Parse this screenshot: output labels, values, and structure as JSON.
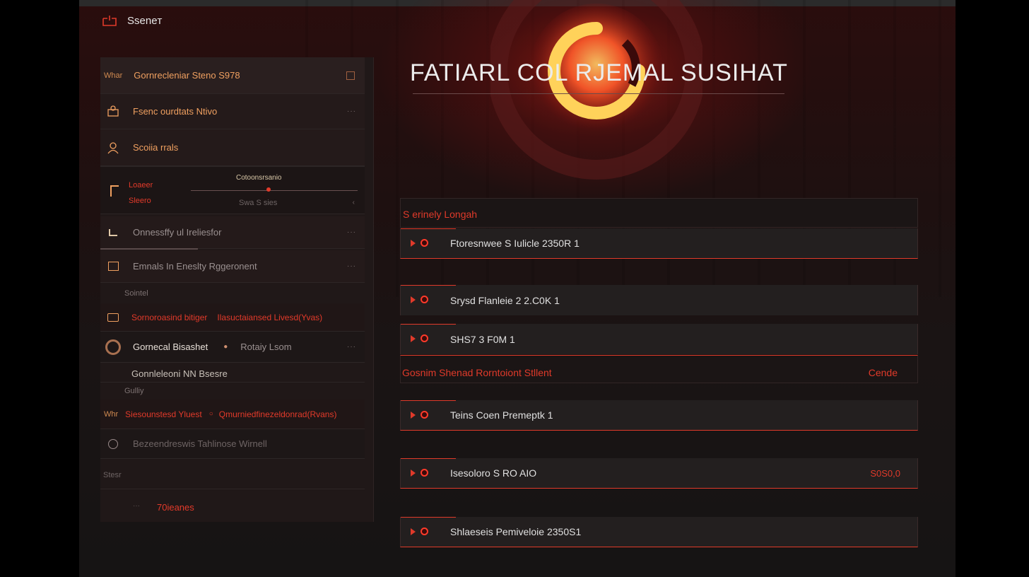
{
  "app": {
    "brand": "Sseneт",
    "title": "FATIARL COL RJEMAL SUSIHAT"
  },
  "sidebar": {
    "items": [
      {
        "prefix": "Whar",
        "label": "Gornrecleniar Steno S978"
      },
      {
        "label": "Fsenc ourdtats Ntivo"
      },
      {
        "label": "Scoiia rrals"
      },
      {
        "label": "Onnessffy ul Ireliesfor"
      },
      {
        "label": "Emnals In Eneslty Rggeronent"
      }
    ],
    "slider": {
      "title": "Cotoonsrsanio",
      "left_top": "Loaeer",
      "left_bottom": "Sleero",
      "caption": "Swa S sies"
    },
    "section_a": "Sointel",
    "red_row": {
      "left": "Sornoroasind bitiger",
      "right": "Ilasuctaiansed Livesd(Yvas)"
    },
    "toggle_row": {
      "label": "Gornecal Bisashet",
      "right": "Rotaiy Lsom"
    },
    "note": "Gonnleleoni NN Bsesre",
    "section_b": "Gulliy",
    "red_row2": {
      "prefix": "Whr",
      "left": "Siesounstesd Yluest",
      "right": "Qmurniedfinezeldonrad(Rvans)"
    },
    "dim_row": {
      "label": "Bezeendreswis Tahlinose Wirnell"
    },
    "footer_small": "Stesr",
    "footer_link": "70ieanes"
  },
  "main": {
    "sub_header": "S erinely Longah",
    "rows": [
      {
        "label": "Ftoresnwee S Iulicle 2350R 1"
      },
      {
        "label": "Srysd Flanleie 2 2.C0K 1"
      },
      {
        "label": "SHS7 3 F0M 1"
      }
    ],
    "footer_left": "Gosnim Shenad Rorntoiont Stllent",
    "footer_right": "Cende",
    "rows2": [
      {
        "label": "Teins Coen Premeptk 1",
        "value": ""
      },
      {
        "label": "Isesoloro S RO AIO",
        "value": "S0S0,0"
      },
      {
        "label": "Shlaeseis Pemiveloie 2350S1",
        "value": ""
      }
    ]
  },
  "colors": {
    "accent": "#e03a2a",
    "orange": "#f0a060",
    "bg": "#1e1414"
  }
}
